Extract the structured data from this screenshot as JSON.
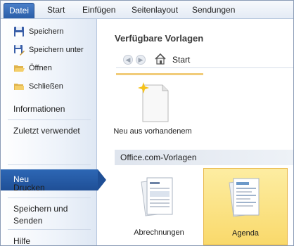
{
  "ribbon": {
    "tabs": [
      "Datei",
      "Start",
      "Einfügen",
      "Seitenlayout",
      "Sendungen"
    ]
  },
  "backstage": {
    "commands": [
      {
        "label": "Speichern",
        "icon": "save-icon"
      },
      {
        "label": "Speichern unter",
        "icon": "save-as-icon"
      },
      {
        "label": "Öffnen",
        "icon": "open-folder-icon"
      },
      {
        "label": "Schließen",
        "icon": "close-document-icon"
      }
    ],
    "tabs": [
      {
        "label": "Informationen"
      },
      {
        "label": "Zuletzt verwendet"
      },
      {
        "label": "Neu",
        "selected": true
      },
      {
        "label": "Drucken"
      },
      {
        "label": "Speichern und Senden"
      },
      {
        "label": "Hilfe"
      }
    ]
  },
  "main": {
    "title": "Verfügbare Vorlagen",
    "breadcrumb": "Start",
    "templates": [
      {
        "label": "Neu aus vorhandenem",
        "icon": "new-from-existing-icon"
      }
    ],
    "online_group": {
      "title": "Office.com-Vorlagen",
      "items": [
        {
          "label": "Abrechnungen",
          "icon": "invoices-icon"
        },
        {
          "label": "Agenda",
          "icon": "agenda-icon",
          "selected": true
        }
      ]
    }
  },
  "colors": {
    "accent_blue": "#2a5ea8",
    "selection_yellow": "#f9d96b"
  }
}
